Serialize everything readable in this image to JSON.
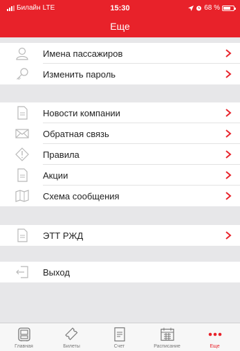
{
  "status_bar": {
    "carrier": "Билайн",
    "network": "LTE",
    "time": "15:30",
    "battery": "68 %",
    "battery_level": 0.68
  },
  "header": {
    "title": "Еще"
  },
  "menu": {
    "group1": [
      {
        "label": "Имена пассажиров",
        "icon": "user-icon",
        "has_chevron": true
      },
      {
        "label": "Изменить пароль",
        "icon": "key-icon",
        "has_chevron": true
      }
    ],
    "group2": [
      {
        "label": "Новости компании",
        "icon": "document-icon",
        "has_chevron": true
      },
      {
        "label": "Обратная связь",
        "icon": "envelope-icon",
        "has_chevron": true
      },
      {
        "label": "Правила",
        "icon": "info-diamond-icon",
        "has_chevron": true
      },
      {
        "label": "Акции",
        "icon": "document-icon",
        "has_chevron": true
      },
      {
        "label": "Схема сообщения",
        "icon": "map-icon",
        "has_chevron": true
      }
    ],
    "group3": [
      {
        "label": "ЭТТ РЖД",
        "icon": "document-icon",
        "has_chevron": true
      }
    ],
    "group4": [
      {
        "label": "Выход",
        "icon": "logout-icon",
        "has_chevron": false
      }
    ]
  },
  "tabbar": {
    "items": [
      {
        "label": "Главная",
        "icon": "home-icon",
        "active": false
      },
      {
        "label": "Билеты",
        "icon": "ticket-icon",
        "active": false
      },
      {
        "label": "Счет",
        "icon": "receipt-icon",
        "active": false
      },
      {
        "label": "Расписание",
        "icon": "calendar-icon",
        "active": false
      },
      {
        "label": "Еще",
        "icon": "more-icon",
        "active": true
      }
    ]
  },
  "colors": {
    "accent": "#e8222a",
    "background": "#e7e7e9",
    "icon_gray": "#b8b8b8"
  }
}
